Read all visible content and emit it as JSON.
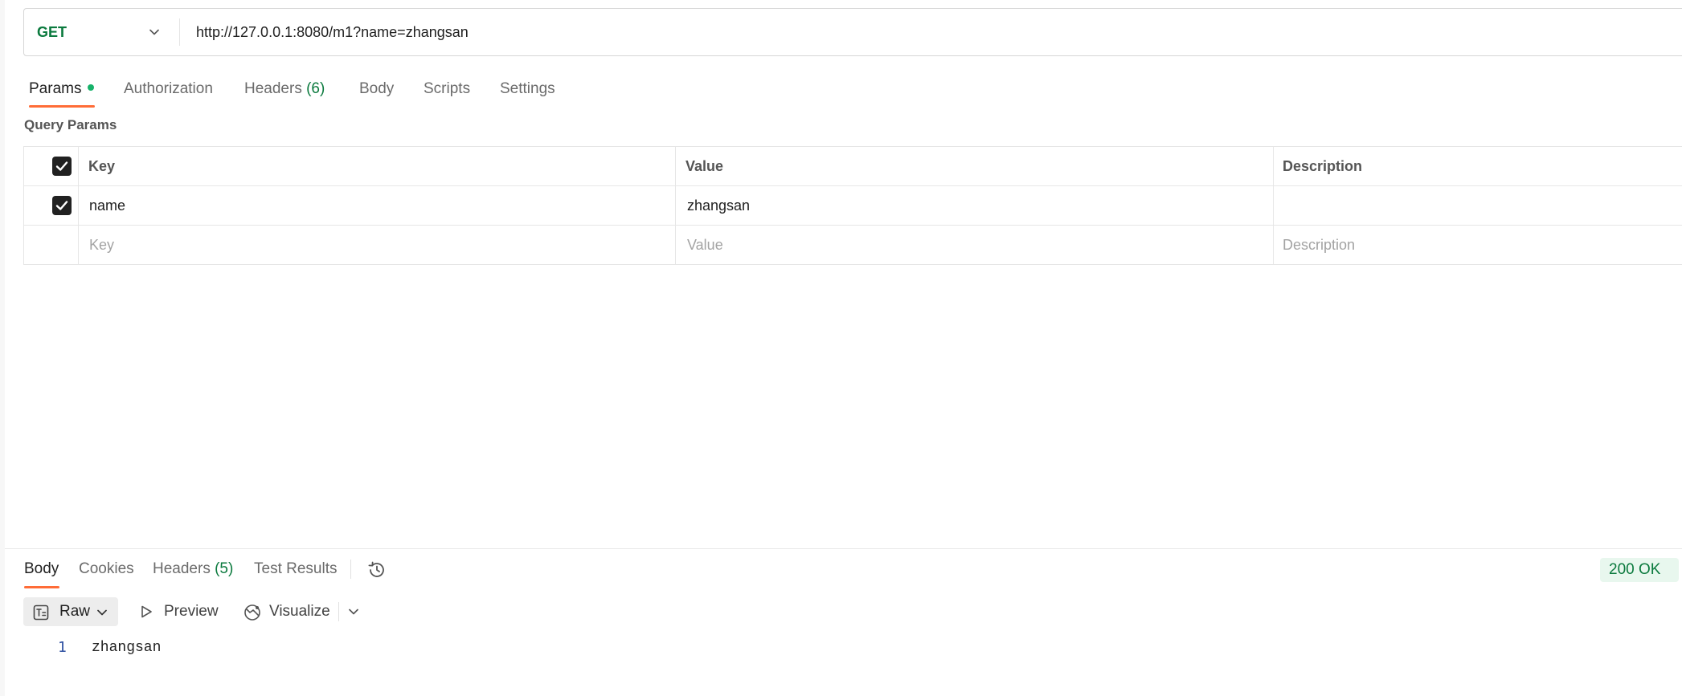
{
  "request": {
    "method": "GET",
    "url": "http://127.0.0.1:8080/m1?name=zhangsan",
    "tabs": [
      {
        "label": "Params",
        "active": true,
        "modified": true
      },
      {
        "label": "Authorization"
      },
      {
        "label": "Headers",
        "count": "(6)"
      },
      {
        "label": "Body"
      },
      {
        "label": "Scripts"
      },
      {
        "label": "Settings"
      }
    ]
  },
  "query_params": {
    "title": "Query Params",
    "headers": {
      "key": "Key",
      "value": "Value",
      "description": "Description"
    },
    "rows": [
      {
        "checked": true,
        "key": "name",
        "value": "zhangsan",
        "description": ""
      }
    ],
    "placeholders": {
      "key": "Key",
      "value": "Value",
      "description": "Description"
    }
  },
  "response": {
    "tabs": [
      {
        "label": "Body",
        "active": true
      },
      {
        "label": "Cookies"
      },
      {
        "label": "Headers",
        "count": "(5)"
      },
      {
        "label": "Test Results"
      }
    ],
    "history_icon": "history-icon",
    "status": "200 OK",
    "toolbar": {
      "raw": "Raw",
      "preview": "Preview",
      "visualize": "Visualize"
    },
    "body_lines": [
      {
        "number": "1",
        "text": "zhangsan"
      }
    ]
  },
  "colors": {
    "accent": "#ff6c37",
    "method_green": "#0b7a3e",
    "modified_dot": "#17b26a",
    "status_bg": "#e8f7ee"
  }
}
